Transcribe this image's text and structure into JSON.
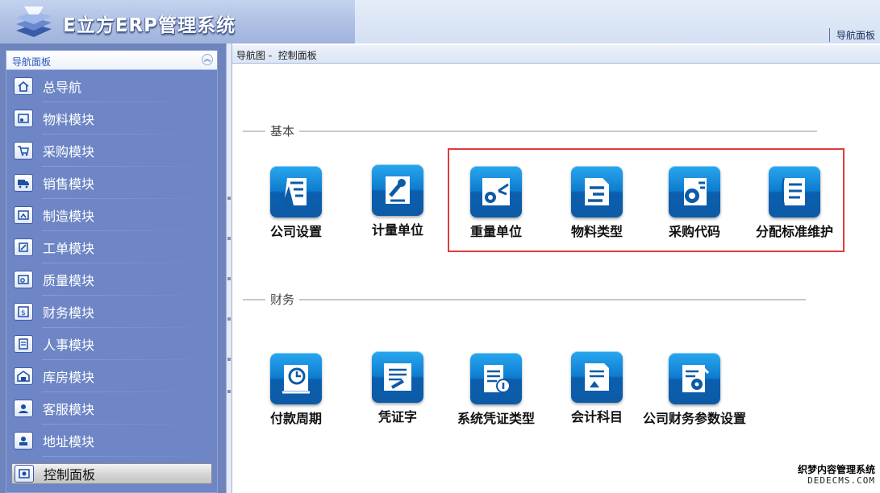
{
  "header": {
    "app_title": "E立方ERP管理系统",
    "nav_panel_link": "导航面板"
  },
  "sidebar": {
    "title": "导航面板",
    "items": [
      {
        "label": "总导航",
        "icon": "home-icon"
      },
      {
        "label": "物料模块",
        "icon": "materials-icon"
      },
      {
        "label": "采购模块",
        "icon": "cart-icon"
      },
      {
        "label": "销售模块",
        "icon": "truck-icon"
      },
      {
        "label": "制造模块",
        "icon": "factory-icon"
      },
      {
        "label": "工单模块",
        "icon": "work-order-icon"
      },
      {
        "label": "质量模块",
        "icon": "quality-icon"
      },
      {
        "label": "财务模块",
        "icon": "finance-icon"
      },
      {
        "label": "人事模块",
        "icon": "personnel-icon"
      },
      {
        "label": "库房模块",
        "icon": "warehouse-icon"
      },
      {
        "label": "客服模块",
        "icon": "customer-service-icon"
      },
      {
        "label": "地址模块",
        "icon": "address-icon"
      }
    ],
    "active_item": {
      "label": "控制面板",
      "icon": "control-panel-icon"
    }
  },
  "breadcrumb": {
    "text": "导航图 -  控制面板"
  },
  "sections": {
    "basic": {
      "title": "基本",
      "tiles": [
        {
          "label": "公司设置",
          "icon": "company-settings-icon"
        },
        {
          "label": "计量单位",
          "icon": "measure-unit-icon"
        },
        {
          "label": "重量单位",
          "icon": "weight-unit-icon"
        },
        {
          "label": "物料类型",
          "icon": "material-type-icon"
        },
        {
          "label": "采购代码",
          "icon": "purchase-code-icon"
        },
        {
          "label": "分配标准维护",
          "icon": "allocation-standard-icon"
        }
      ]
    },
    "finance": {
      "title": "财务",
      "tiles": [
        {
          "label": "付款周期",
          "icon": "payment-cycle-icon"
        },
        {
          "label": "凭证字",
          "icon": "voucher-word-icon"
        },
        {
          "label": "系统凭证类型",
          "icon": "voucher-type-icon"
        },
        {
          "label": "会计科目",
          "icon": "account-subject-icon"
        },
        {
          "label": "公司财务参数设置",
          "icon": "finance-params-icon"
        }
      ]
    }
  },
  "watermark": {
    "line1": "织梦内容管理系统",
    "line2": "DEDECMS.COM"
  },
  "colors": {
    "highlight": "#e23b3b",
    "tile_blue": "#0e7ccf",
    "sidebar_blue": "#6e86c6"
  }
}
